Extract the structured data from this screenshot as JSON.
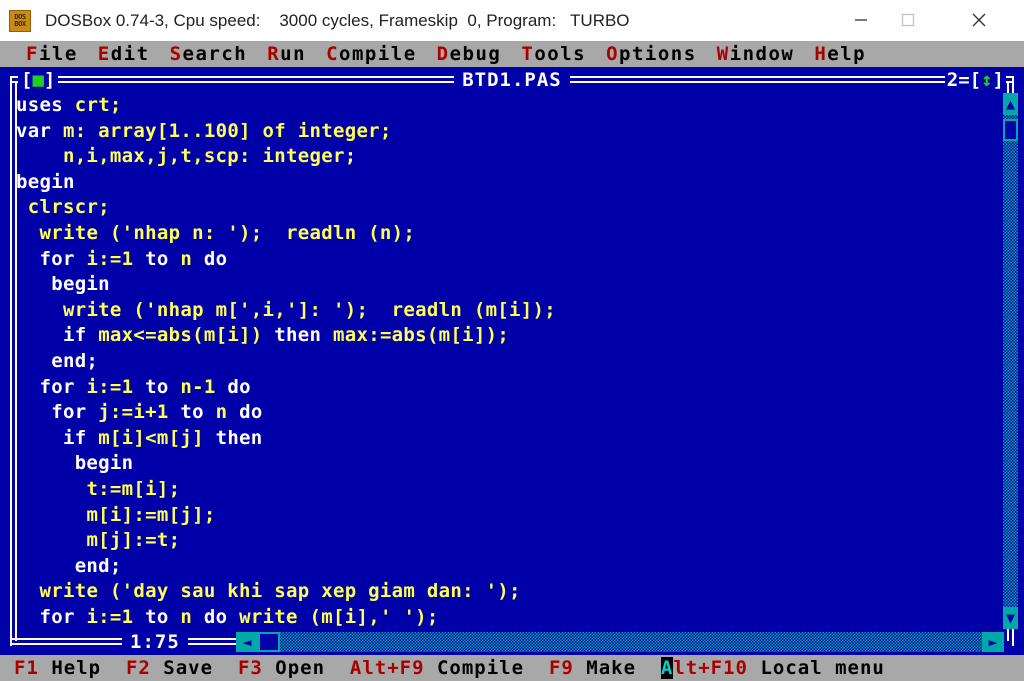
{
  "window": {
    "title": "DOSBox 0.74-3, Cpu speed:    3000 cycles, Frameskip  0, Program:   TURBO",
    "minimize_label": "minimize",
    "maximize_label": "maximize",
    "close_label": "close",
    "icon_line1": "DOS",
    "icon_line2": "BOX"
  },
  "menubar": {
    "items": [
      {
        "hot": "F",
        "rest": "ile"
      },
      {
        "hot": "E",
        "rest": "dit"
      },
      {
        "hot": "S",
        "rest": "earch"
      },
      {
        "hot": "R",
        "rest": "un"
      },
      {
        "hot": "C",
        "rest": "ompile"
      },
      {
        "hot": "D",
        "rest": "ebug"
      },
      {
        "hot": "T",
        "rest": "ools"
      },
      {
        "hot": "O",
        "rest": "ptions"
      },
      {
        "hot": "W",
        "rest": "indow"
      },
      {
        "hot": "H",
        "rest": "elp"
      }
    ]
  },
  "editor": {
    "filename": "BTD1.PAS",
    "window_number": "2",
    "close_box_left": "[",
    "close_box_right": "]",
    "close_box_glyph": "■",
    "resize_glyph": "↕",
    "cursor_position": "1:75",
    "scrollbar": {
      "up_arrow": "▲",
      "down_arrow": "▼",
      "left_arrow": "◄",
      "right_arrow": "►"
    },
    "code_lines": [
      [
        {
          "t": "uses",
          "c": "kw"
        },
        {
          "t": " ",
          "c": "kw"
        },
        {
          "t": "crt;",
          "c": "id"
        }
      ],
      [
        {
          "t": "var",
          "c": "kw"
        },
        {
          "t": " ",
          "c": "kw"
        },
        {
          "t": "m: array[1..100] of integer;",
          "c": "id"
        }
      ],
      [
        {
          "t": "    n,i,max,j,t,scp: integer;",
          "c": "id"
        }
      ],
      [
        {
          "t": "begin",
          "c": "kw"
        }
      ],
      [
        {
          "t": " ",
          "c": "kw"
        },
        {
          "t": "clrscr;",
          "c": "id"
        }
      ],
      [
        {
          "t": "  ",
          "c": "kw"
        },
        {
          "t": "write ('nhap n: ');  readln (n);",
          "c": "id"
        }
      ],
      [
        {
          "t": "  for ",
          "c": "kw"
        },
        {
          "t": "i:=1",
          "c": "id"
        },
        {
          "t": " to ",
          "c": "kw"
        },
        {
          "t": "n",
          "c": "id"
        },
        {
          "t": " do",
          "c": "kw"
        }
      ],
      [
        {
          "t": "   begin",
          "c": "kw"
        }
      ],
      [
        {
          "t": "    ",
          "c": "kw"
        },
        {
          "t": "write ('nhap m[',i,']: ');  readln (m[i]);",
          "c": "id"
        }
      ],
      [
        {
          "t": "    if ",
          "c": "kw"
        },
        {
          "t": "max<=abs(m[i])",
          "c": "id"
        },
        {
          "t": " then ",
          "c": "kw"
        },
        {
          "t": "max:=abs(m[i]);",
          "c": "id"
        }
      ],
      [
        {
          "t": "   end;",
          "c": "kw"
        }
      ],
      [
        {
          "t": "  for ",
          "c": "kw"
        },
        {
          "t": "i:=1",
          "c": "id"
        },
        {
          "t": " to ",
          "c": "kw"
        },
        {
          "t": "n-1",
          "c": "id"
        },
        {
          "t": " do",
          "c": "kw"
        }
      ],
      [
        {
          "t": "   for ",
          "c": "kw"
        },
        {
          "t": "j:=i+1",
          "c": "id"
        },
        {
          "t": " to ",
          "c": "kw"
        },
        {
          "t": "n",
          "c": "id"
        },
        {
          "t": " do",
          "c": "kw"
        }
      ],
      [
        {
          "t": "    if ",
          "c": "kw"
        },
        {
          "t": "m[i]<m[j]",
          "c": "id"
        },
        {
          "t": " then",
          "c": "kw"
        }
      ],
      [
        {
          "t": "     begin",
          "c": "kw"
        }
      ],
      [
        {
          "t": "      ",
          "c": "kw"
        },
        {
          "t": "t:=m[i];",
          "c": "id"
        }
      ],
      [
        {
          "t": "      ",
          "c": "kw"
        },
        {
          "t": "m[i]:=m[j];",
          "c": "id"
        }
      ],
      [
        {
          "t": "      ",
          "c": "kw"
        },
        {
          "t": "m[j]:=t;",
          "c": "id"
        }
      ],
      [
        {
          "t": "     end;",
          "c": "kw"
        }
      ],
      [
        {
          "t": "  ",
          "c": "kw"
        },
        {
          "t": "write ('day sau khi sap xep giam dan: ');",
          "c": "id"
        }
      ],
      [
        {
          "t": "  for ",
          "c": "kw"
        },
        {
          "t": "i:=1",
          "c": "id"
        },
        {
          "t": " to ",
          "c": "kw"
        },
        {
          "t": "n",
          "c": "id"
        },
        {
          "t": " do ",
          "c": "kw"
        },
        {
          "t": "write (m[i],' ');",
          "c": "id"
        }
      ]
    ]
  },
  "function_keys": [
    {
      "key": "F1",
      "label": " Help  "
    },
    {
      "key": "F2",
      "label": " Save  "
    },
    {
      "key": "F3",
      "label": " Open  "
    },
    {
      "key": "Alt+F9",
      "label": " Compile  "
    },
    {
      "key": "F9",
      "label": " Make  "
    },
    {
      "key": "Alt+F10",
      "label": " Local menu",
      "cursor_on_first_char": true
    }
  ],
  "colors": {
    "dos_blue": "#0000a8",
    "dos_gray": "#a8a8a8",
    "dos_cyan": "#00a8a8",
    "dos_red": "#a80000",
    "dos_yellow": "#ffff55",
    "dos_green": "#20d020",
    "dos_white": "#ffffff"
  }
}
